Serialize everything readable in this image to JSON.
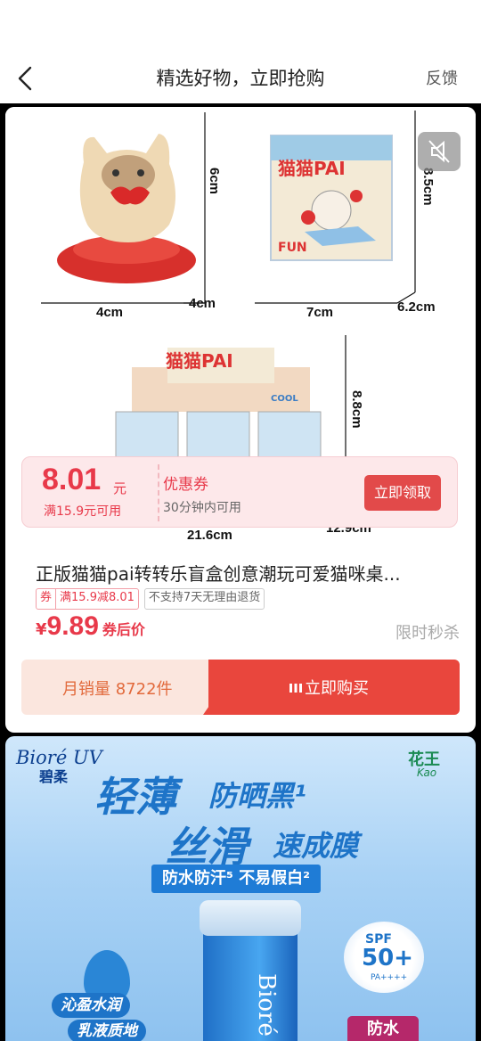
{
  "header": {
    "title": "精选好物，立即抢购",
    "feedback": "反馈"
  },
  "product_media": {
    "dimensions": {
      "figure_height": "6cm",
      "figure_width": "4cm",
      "figure_depth": "4cm",
      "box_height": "8.5cm",
      "box_width": "7cm",
      "box_depth": "6.2cm",
      "display_height": "8.8cm",
      "display_width": "21.6cm",
      "display_depth": "12.9cm"
    },
    "box_brand": "猫猫PAI",
    "box_word": "FUN",
    "display_tag": "COOL"
  },
  "coupon": {
    "amount": "8.01",
    "unit": "元",
    "condition": "满15.9元可用",
    "name": "优惠券",
    "validity": "30分钟内可用",
    "button": "立即领取"
  },
  "product": {
    "title": "正版猫猫pai转转乐盲盒创意潮玩可爱猫咪桌...",
    "tag_coupon_label": "券",
    "tag_coupon_text": "满15.9减8.01",
    "tag_return": "不支持7天无理由退货",
    "price_symbol": "¥",
    "price": "9.89",
    "price_note": "券后价",
    "limited": "限时秒杀"
  },
  "buy_bar": {
    "monthly_sales": "月销量 8722件",
    "button": "立即购买"
  },
  "ad": {
    "brand": "Bioré UV",
    "brand_cn": "碧柔",
    "maker_cn": "花王",
    "maker_en": "Kao",
    "line1_big": "轻薄",
    "line1_small": "防晒黑¹",
    "line2_big": "丝滑",
    "line2_small": "速成膜",
    "pill": "防水防汗⁵ 不易假白²",
    "bottle_text": "Bioré",
    "spf_label": "SPF",
    "spf_value": "50+",
    "pa": "PA++++",
    "badge1": "沁盈水润",
    "badge2": "乳液质地",
    "water": "防水"
  },
  "colors": {
    "accent_red": "#e8394a",
    "buy_red": "#e9463d",
    "sales_orange": "#e26a3c",
    "ad_blue": "#1e74c8"
  }
}
